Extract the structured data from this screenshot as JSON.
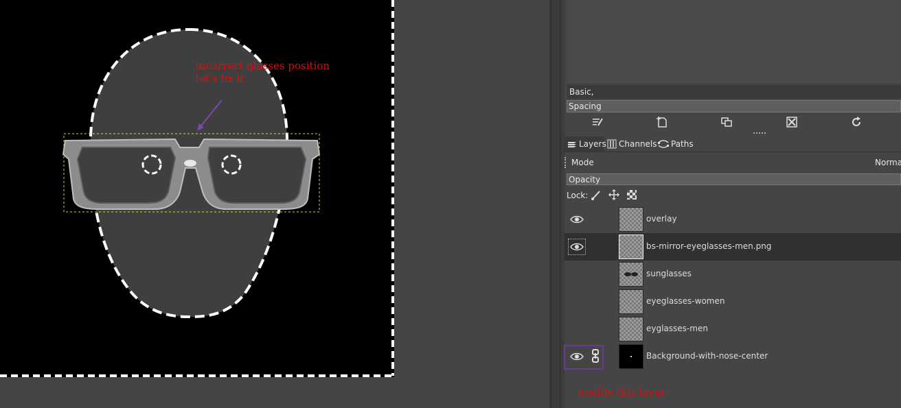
{
  "canvas": {
    "annotation_top": "incorrect glasses position\nlet's fix it",
    "annotation_bottom": "enable this layer"
  },
  "brushes": {
    "preset": "Basic,",
    "spacing_label": "Spacing"
  },
  "toolbar": {
    "icons": [
      "edit-brush-icon",
      "new-brush-icon",
      "duplicate-brush-icon",
      "delete-brush-icon",
      "refresh-brushes-icon"
    ]
  },
  "tabs": [
    {
      "label": "Layers",
      "icon": "layers-icon"
    },
    {
      "label": "Channels",
      "icon": "channels-icon"
    },
    {
      "label": "Paths",
      "icon": "paths-icon"
    }
  ],
  "layers_panel": {
    "mode_label": "Mode",
    "mode_value": "Norma",
    "opacity_label": "Opacity",
    "lock_label": "Lock:"
  },
  "layers": [
    {
      "name": "overlay",
      "visible": true,
      "selected": false
    },
    {
      "name": "bs-mirror-eyeglasses-men.png",
      "visible": true,
      "selected": true
    },
    {
      "name": "sunglasses",
      "visible": false,
      "selected": false
    },
    {
      "name": "eyeglasses-women",
      "visible": false,
      "selected": false
    },
    {
      "name": "eyglasses-men",
      "visible": false,
      "selected": false
    },
    {
      "name": "Background-with-nose-center",
      "visible": true,
      "selected": false,
      "linked": true
    }
  ],
  "colors": {
    "annotation": "#d81010",
    "highlight_box": "#6a3a9a",
    "arrow": "#7a4aaa"
  }
}
